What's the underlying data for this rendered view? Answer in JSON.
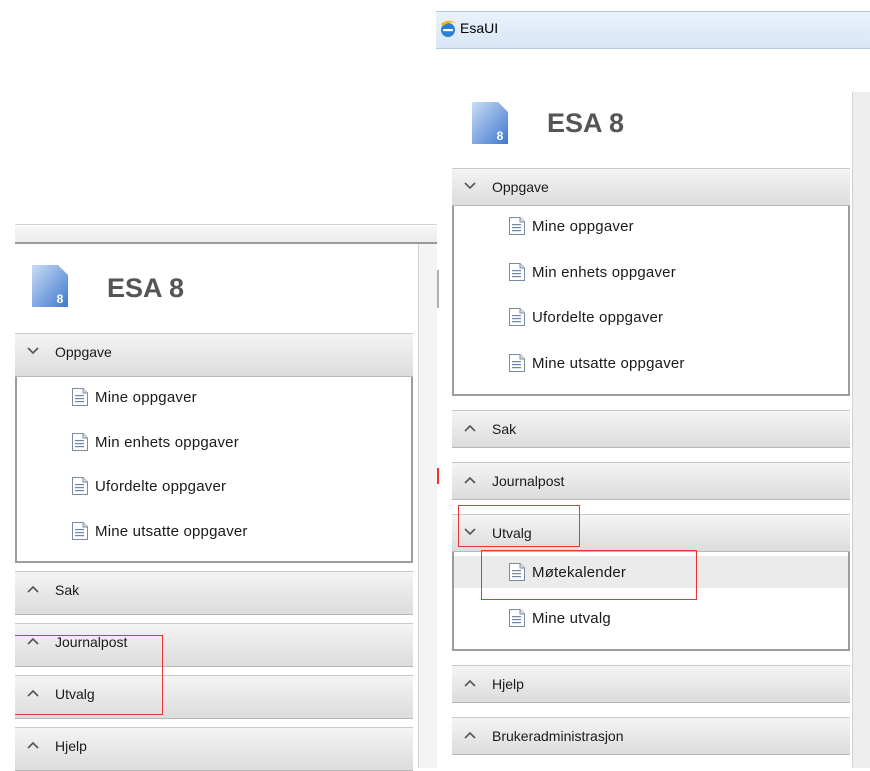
{
  "right": {
    "window_title": "EsaUI",
    "logo_text": "ESA 8",
    "logo_number": "8",
    "sections": [
      {
        "label": "Oppgave",
        "expanded": true,
        "items": [
          "Mine oppgaver",
          "Min enhets oppgaver",
          "Ufordelte oppgaver",
          "Mine utsatte oppgaver"
        ]
      },
      {
        "label": "Sak",
        "expanded": false
      },
      {
        "label": "Journalpost",
        "expanded": false
      },
      {
        "label": "Utvalg",
        "expanded": true,
        "items": [
          "Møtekalender",
          "Mine utvalg"
        ],
        "selected": "Møtekalender"
      },
      {
        "label": "Hjelp",
        "expanded": false
      },
      {
        "label": "Brukeradministrasjon",
        "expanded": false
      }
    ]
  },
  "left": {
    "logo_text": "ESA 8",
    "logo_number": "8",
    "sections": [
      {
        "label": "Oppgave",
        "expanded": true,
        "items": [
          "Mine oppgaver",
          "Min enhets oppgaver",
          "Ufordelte oppgaver",
          "Mine utsatte oppgaver"
        ]
      },
      {
        "label": "Sak",
        "expanded": false
      },
      {
        "label": "Journalpost",
        "expanded": false
      },
      {
        "label": "Utvalg",
        "expanded": false
      },
      {
        "label": "Hjelp",
        "expanded": false
      }
    ]
  },
  "colors": {
    "highlight_box": "#e33333",
    "logo_blue": "#5b8fd6"
  },
  "icons": {
    "expanded": "chevron-down-icon",
    "collapsed": "chevron-up-icon",
    "item": "document-icon",
    "browser": "ie-icon"
  }
}
